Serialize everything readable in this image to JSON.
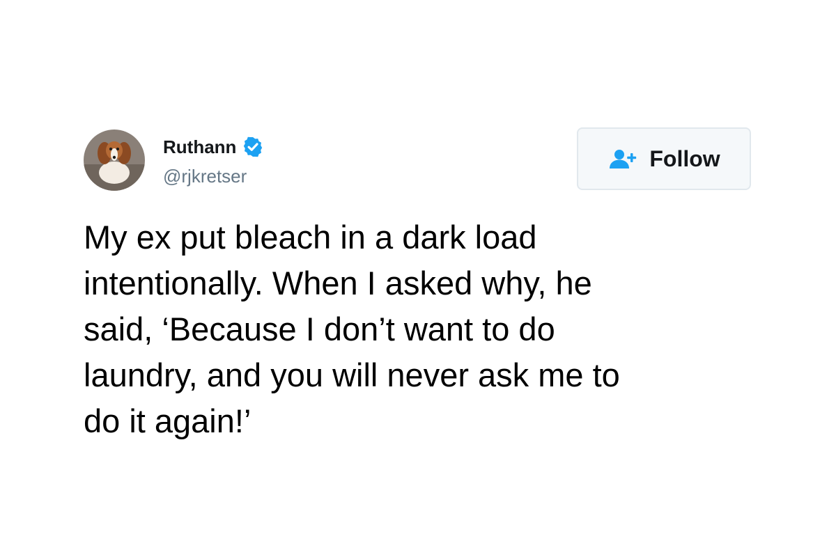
{
  "tweet": {
    "author": {
      "display_name": "Ruthann",
      "handle": "@rjkretser",
      "verified": true,
      "avatar": "dog-photo-avatar"
    },
    "follow_button": {
      "label": "Follow",
      "icon": "add-user-icon"
    },
    "text_lines": [
      "My ex put bleach in a dark load",
      "intentionally. When I asked why, he",
      "said, ‘Because I don’t want to do",
      "laundry, and you will never ask me to",
      "do it again!’"
    ]
  },
  "colors": {
    "verified_badge": "#1da1f2",
    "handle_text": "#657786",
    "follow_border": "#e1e8ed",
    "follow_background": "#f5f8fa",
    "follow_icon": "#1da1f2",
    "text": "#000000"
  }
}
